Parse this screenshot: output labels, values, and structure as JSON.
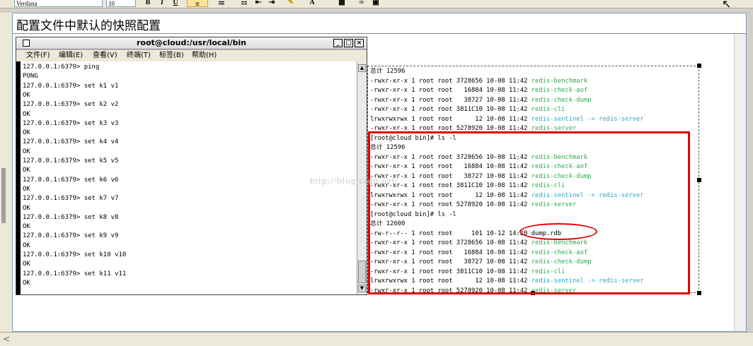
{
  "toolbar": {
    "font_name": "Verdana",
    "font_size": "10",
    "bold": "B",
    "italic": "I",
    "underline": "U"
  },
  "document": {
    "title": "配置文件中默认的快照配置",
    "watermark": "http://blog.csdn.net/"
  },
  "terminal": {
    "title": "root@cloud:/usr/local/bin",
    "menu": [
      "文件(F)",
      "编辑(E)",
      "查看(V)",
      "终端(T)",
      "标签(B)",
      "帮助(H)"
    ],
    "lines": [
      "127.0.0.1:6379> ping",
      "PONG",
      "127.0.0.1:6379> set k1 v1",
      "OK",
      "127.0.0.1:6379> set k2 v2",
      "OK",
      "127.0.0.1:6379> set k3 v3",
      "OK",
      "127.0.0.1:6379> set k4 v4",
      "OK",
      "127.0.0.1:6379> set k5 v5",
      "OK",
      "127.0.0.1:6379> set k6 v6",
      "OK",
      "127.0.0.1:6379> set k7 v7",
      "OK",
      "127.0.0.1:6379> set k8 v8",
      "OK",
      "127.0.0.1:6379> set k9 v9",
      "OK",
      "127.0.0.1:6379> set k10 v10",
      "OK",
      "127.0.0.1:6379> set k11 v11",
      "OK"
    ]
  },
  "listing": {
    "lines": [
      {
        "pre": "总计 12596",
        "name": "",
        "type": "plain"
      },
      {
        "pre": "-rwxr-xr-x 1 root root 3728656 10-08 11:42 ",
        "name": "redis-benchmark",
        "type": "exec"
      },
      {
        "pre": "-rwxr-xr-x 1 root root   16884 10-08 11:42 ",
        "name": "redis-check-aof",
        "type": "exec"
      },
      {
        "pre": "-rwxr-xr-x 1 root root   38727 10-08 11:42 ",
        "name": "redis-check-dump",
        "type": "exec"
      },
      {
        "pre": "-rwxr-xr-x 1 root root 3811C10 10-08 11:42 ",
        "name": "redis-cli",
        "type": "exec"
      },
      {
        "pre": "lrwxrwxrwx 1 root root      12 10-08 11:42 ",
        "name": "redis-sentinel -> redis-server",
        "type": "link"
      },
      {
        "pre": "-rwxr-xr-x 1 root root 5278920 10-08 11:42 ",
        "name": "redis-server",
        "type": "exec"
      },
      {
        "pre": "[root@cloud bin]# ls -l",
        "name": "",
        "type": "plain"
      },
      {
        "pre": "总计 12596",
        "name": "",
        "type": "plain"
      },
      {
        "pre": "-rwxr-xr-x 1 root root 3728656 10-08 11:42 ",
        "name": "redis-benchmark",
        "type": "exec"
      },
      {
        "pre": "-rwxr-xr-x 1 root root   16884 10-08 11:42 ",
        "name": "redis-check-aof",
        "type": "exec"
      },
      {
        "pre": "-rwxr-xr-x 1 root root   38727 10-08 11:42 ",
        "name": "redis-check-dump",
        "type": "exec"
      },
      {
        "pre": "-rwxr-xr-x 1 root root 3811C10 10-08 11:42 ",
        "name": "redis-cli",
        "type": "exec"
      },
      {
        "pre": "lrwxrwxrwx 1 root root      12 10-08 11:42 ",
        "name": "redis-sentinel -> redis-server",
        "type": "link"
      },
      {
        "pre": "-rwxr-xr-x 1 root root 5278920 10-08 11:42 ",
        "name": "redis-server",
        "type": "exec"
      },
      {
        "pre": "[root@cloud bin]# ls -l",
        "name": "",
        "type": "plain"
      },
      {
        "pre": "总计 12600",
        "name": "",
        "type": "plain"
      },
      {
        "pre": "-rw-r--r-- 1 root root     101 10-12 14:20 dump.rdb",
        "name": "",
        "type": "plain"
      },
      {
        "pre": "-rwxr-xr-x 1 root root 3728656 10-08 11:42 ",
        "name": "redis-benchmark",
        "type": "exec"
      },
      {
        "pre": "-rwxr-xr-x 1 root root   16884 10-08 11:42 ",
        "name": "redis-check-aof",
        "type": "exec"
      },
      {
        "pre": "-rwxr-xr-x 1 root root   38727 10-08 11:42 ",
        "name": "redis-check-dump",
        "type": "exec"
      },
      {
        "pre": "-rwxr-xr-x 1 root root 3811C10 10-08 11:42 ",
        "name": "redis-cli",
        "type": "exec"
      },
      {
        "pre": "lrwxrwxrwx 1 root root      12 10-08 11:42 ",
        "name": "redis-sentinel -> redis-server",
        "type": "link"
      },
      {
        "pre": "-rwxr-xr-x 1 root root 5278920 10-08 11:42 ",
        "name": "redis-server",
        "type": "exec"
      }
    ]
  },
  "colors": {
    "exec": "#2fa84f",
    "link": "#28a8c8",
    "highlight": "#e00000"
  }
}
